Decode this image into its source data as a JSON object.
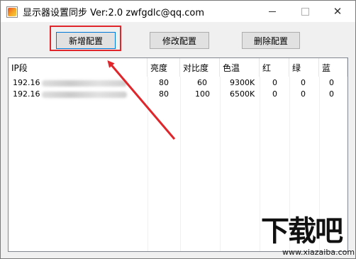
{
  "window": {
    "title": "显示器设置同步  Ver:2.0 zwfgdlc@qq.com",
    "minimize_glyph": "",
    "close_glyph": "✕"
  },
  "toolbar": {
    "add_label": "新增配置",
    "edit_label": "修改配置",
    "delete_label": "删除配置"
  },
  "table": {
    "columns": [
      "IP段",
      "亮度",
      "对比度",
      "色温",
      "红",
      "绿",
      "蓝"
    ],
    "rows": [
      {
        "ip": "192.16",
        "brightness": "80",
        "contrast": "60",
        "color_temp": "9300K",
        "red": "0",
        "green": "0",
        "blue": "0"
      },
      {
        "ip": "192.16",
        "brightness": "80",
        "contrast": "100",
        "color_temp": "6500K",
        "red": "0",
        "green": "0",
        "blue": "0"
      }
    ]
  },
  "annotation": {
    "highlight_color": "#e0252b"
  },
  "watermark": {
    "logo_text": "下载吧",
    "url": "www.xiazaiba.com"
  }
}
